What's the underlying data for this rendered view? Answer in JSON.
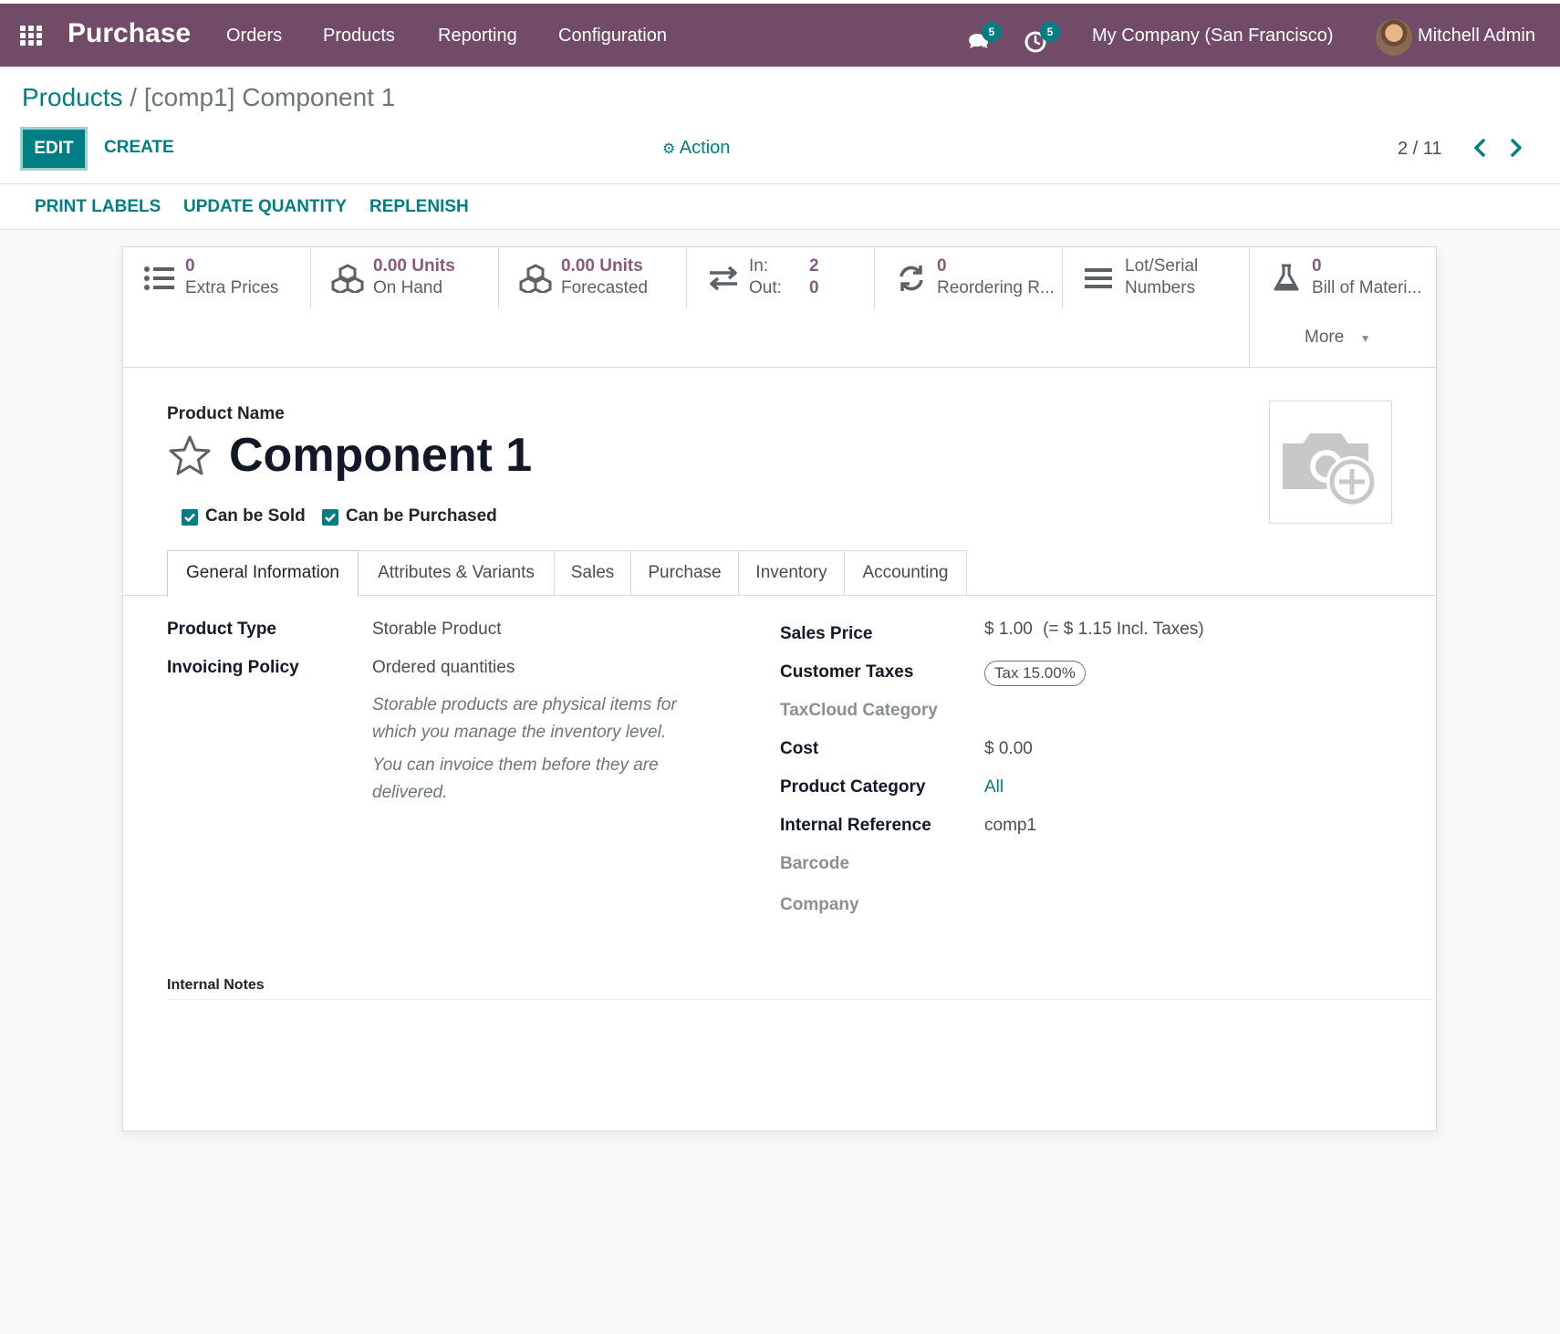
{
  "navbar": {
    "app_name": "Purchase",
    "menu": [
      "Orders",
      "Products",
      "Reporting",
      "Configuration"
    ],
    "messages_count": "5",
    "activities_count": "5",
    "company": "My Company (San Francisco)",
    "user": "Mitchell Admin",
    "bg_color": "#714b67"
  },
  "breadcrumb": {
    "parent": "Products",
    "separator": "/",
    "current": "[comp1] Component 1"
  },
  "control": {
    "edit_label": "EDIT",
    "create_label": "CREATE",
    "action_label": "Action",
    "pager": "2 / 11"
  },
  "statusbar": {
    "buttons": [
      "PRINT LABELS",
      "UPDATE QUANTITY",
      "REPLENISH"
    ]
  },
  "smart_buttons": {
    "extra_prices": {
      "value": "0",
      "label": "Extra Prices"
    },
    "on_hand": {
      "value": "0.00 Units",
      "label": "On Hand"
    },
    "forecasted": {
      "value": "0.00 Units",
      "label": "Forecasted"
    },
    "in_out": {
      "in_label": "In:",
      "in_value": "2",
      "out_label": "Out:",
      "out_value": "0"
    },
    "reordering": {
      "value": "0",
      "label": "Reordering R..."
    },
    "lots": {
      "line1": "Lot/Serial",
      "line2": "Numbers"
    },
    "bom": {
      "value": "0",
      "label": "Bill of Materi..."
    },
    "more_label": "More"
  },
  "product": {
    "name_label": "Product Name",
    "name": "Component 1",
    "can_be_sold_label": "Can be Sold",
    "can_be_purchased_label": "Can be Purchased"
  },
  "tabs": [
    "General Information",
    "Attributes & Variants",
    "Sales",
    "Purchase",
    "Inventory",
    "Accounting"
  ],
  "general": {
    "product_type_label": "Product Type",
    "product_type": "Storable Product",
    "invoicing_policy_label": "Invoicing Policy",
    "invoicing_policy": "Ordered quantities",
    "help1_a": "Storable products are physical items for",
    "help1_b": "which you manage the inventory level.",
    "help2_a": "You can invoice them before they are",
    "help2_b": "delivered.",
    "sales_price_label": "Sales Price",
    "sales_price": "$ 1.00",
    "sales_price_incl": "(= $ 1.15 Incl. Taxes)",
    "customer_taxes_label": "Customer Taxes",
    "customer_tax": "Tax 15.00%",
    "taxcloud_label": "TaxCloud Category",
    "cost_label": "Cost",
    "cost": "$ 0.00",
    "category_label": "Product Category",
    "category": "All",
    "internal_ref_label": "Internal Reference",
    "internal_ref": "comp1",
    "barcode_label": "Barcode",
    "company_label": "Company",
    "notes_label": "Internal Notes"
  }
}
